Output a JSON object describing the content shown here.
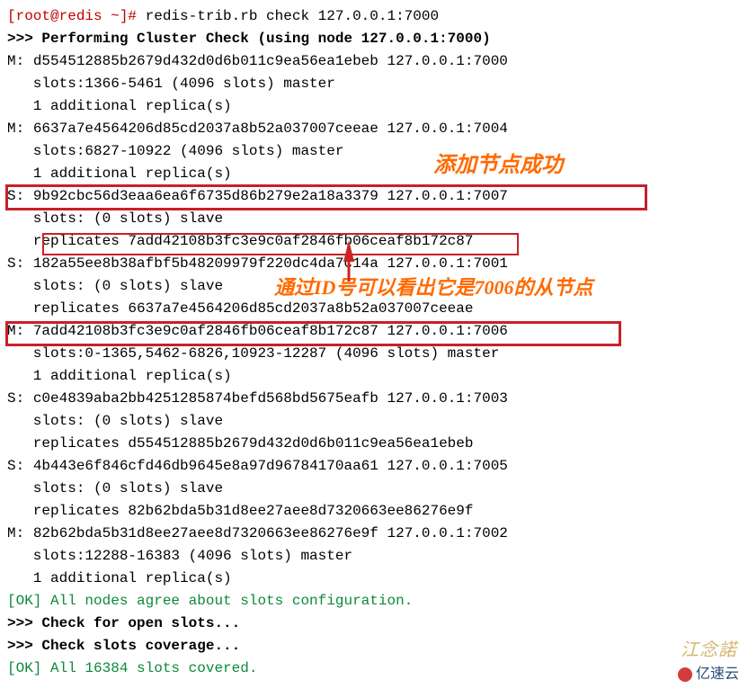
{
  "prompt": "[root@redis ~]# ",
  "command": "redis-trib.rb check 127.0.0.1:7000",
  "header": ">>> Performing Cluster Check (using node 127.0.0.1:7000)",
  "nodes": [
    {
      "t": "M",
      "id": "d554512885b2679d432d0d6b011c9ea56ea1ebeb",
      "addr": "127.0.0.1:7000",
      "l2": "   slots:1366-5461 (4096 slots) master",
      "l3": "   1 additional replica(s)"
    },
    {
      "t": "M",
      "id": "6637a7e4564206d85cd2037a8b52a037007ceeae",
      "addr": "127.0.0.1:7004",
      "l2": "   slots:6827-10922 (4096 slots) master",
      "l3": "   1 additional replica(s)"
    },
    {
      "t": "S",
      "id": "9b92cbc56d3eaa6ea6f6735d86b279e2a18a3379",
      "addr": "127.0.0.1:7007",
      "l2": "   slots: (0 slots) slave",
      "l3": "   replicates 7add42108b3fc3e9c0af2846fb06ceaf8b172c87"
    },
    {
      "t": "S",
      "id": "182a55ee8b38afbf5b48209979f220dc4da7c14a",
      "addr": "127.0.0.1:7001",
      "l2": "   slots: (0 slots) slave",
      "l3": "   replicates 6637a7e4564206d85cd2037a8b52a037007ceeae"
    },
    {
      "t": "M",
      "id": "7add42108b3fc3e9c0af2846fb06ceaf8b172c87",
      "addr": "127.0.0.1:7006",
      "l2": "   slots:0-1365,5462-6826,10923-12287 (4096 slots) master",
      "l3": "   1 additional replica(s)"
    },
    {
      "t": "S",
      "id": "c0e4839aba2bb4251285874befd568bd5675eafb",
      "addr": "127.0.0.1:7003",
      "l2": "   slots: (0 slots) slave",
      "l3": "   replicates d554512885b2679d432d0d6b011c9ea56ea1ebeb"
    },
    {
      "t": "S",
      "id": "4b443e6f846cfd46db9645e8a97d96784170aa61",
      "addr": "127.0.0.1:7005",
      "l2": "   slots: (0 slots) slave",
      "l3": "   replicates 82b62bda5b31d8ee27aee8d7320663ee86276e9f"
    },
    {
      "t": "M",
      "id": "82b62bda5b31d8ee27aee8d7320663ee86276e9f",
      "addr": "127.0.0.1:7002",
      "l2": "   slots:12288-16383 (4096 slots) master",
      "l3": "   1 additional replica(s)"
    }
  ],
  "ok1": "[OK] All nodes agree about slots configuration.",
  "check_open": ">>> Check for open slots...",
  "check_cov": ">>> Check slots coverage...",
  "ok2": "[OK] All 16384 slots covered.",
  "anno1": "添加节点成功",
  "anno2": "通过ID号可以看出它是7006的从节点",
  "wm": "江念諾",
  "logo": "亿速云"
}
